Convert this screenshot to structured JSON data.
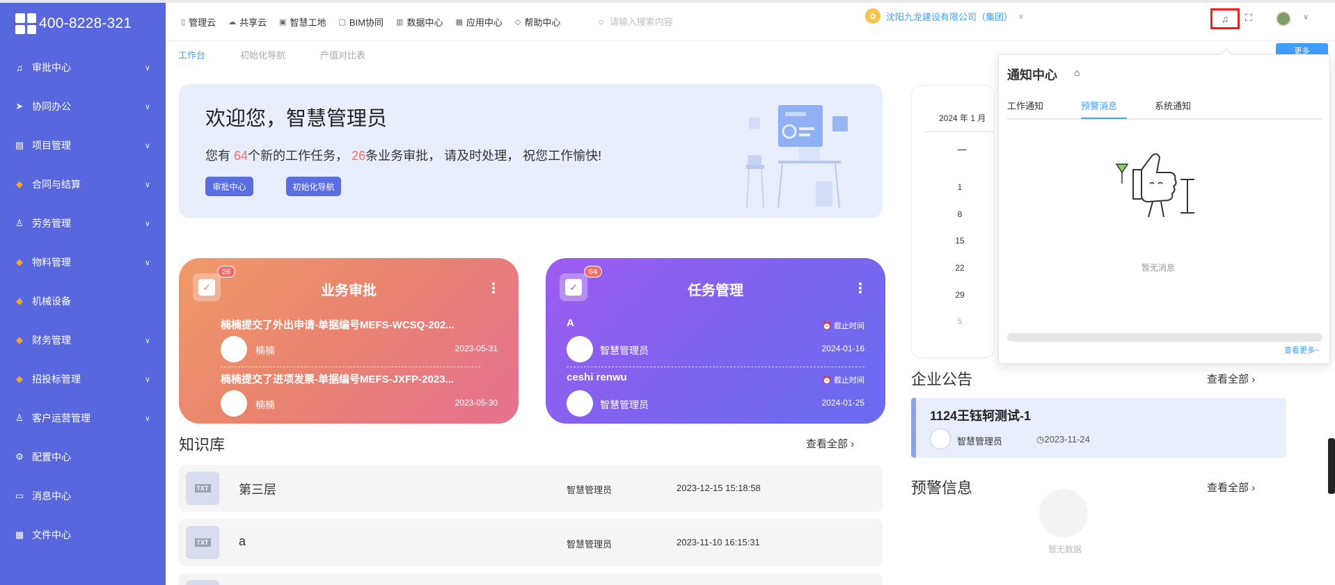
{
  "sidebar": {
    "phone": "400-8228-321",
    "items": [
      {
        "label": "审批中心",
        "icon": "bell-icon",
        "glyph": "♫",
        "has_children": true
      },
      {
        "label": "协同办公",
        "icon": "send-icon",
        "glyph": "➤",
        "has_children": true
      },
      {
        "label": "项目管理",
        "icon": "book-icon",
        "glyph": "▤",
        "has_children": true
      },
      {
        "label": "合同与结算",
        "icon": "diamond-icon",
        "glyph": "◆",
        "has_children": true
      },
      {
        "label": "劳务管理",
        "icon": "user-icon",
        "glyph": "♙",
        "has_children": true
      },
      {
        "label": "物料管理",
        "icon": "diamond-icon",
        "glyph": "◆",
        "has_children": true
      },
      {
        "label": "机械设备",
        "icon": "diamond-icon",
        "glyph": "◆",
        "has_children": false
      },
      {
        "label": "财务管理",
        "icon": "diamond-icon",
        "glyph": "◆",
        "has_children": true
      },
      {
        "label": "招投标管理",
        "icon": "diamond-icon",
        "glyph": "◆",
        "has_children": true
      },
      {
        "label": "客户运营管理",
        "icon": "user-icon",
        "glyph": "♙",
        "has_children": true
      },
      {
        "label": "配置中心",
        "icon": "gear-icon",
        "glyph": "⚙",
        "has_children": false
      },
      {
        "label": "消息中心",
        "icon": "message-icon",
        "glyph": "▭",
        "has_children": false
      },
      {
        "label": "文件中心",
        "icon": "file-icon",
        "glyph": "▦",
        "has_children": false
      }
    ]
  },
  "topnav": {
    "links": [
      "管理云",
      "共享云",
      "智慧工地",
      "BIM协同",
      "数据中心",
      "应用中心",
      "帮助中心"
    ],
    "search_placeholder": "请输入搜索内容",
    "company": "沈阳九龙建设有限公司（集团）"
  },
  "subnav": {
    "tabs": [
      "工作台",
      "初始化导航",
      "产值对比表"
    ],
    "active": 0,
    "more_label": "更多"
  },
  "welcome": {
    "title": "欢迎您，智慧管理员",
    "msg_pre": "您有 ",
    "tasks": "64",
    "msg_mid": "个新的工作任务， ",
    "approvals": "26",
    "msg_post": "条业务审批， 请及时处理， 祝您工作愉快!",
    "btn_approval": "审批中心",
    "btn_nav": "初始化导航"
  },
  "biz_card": {
    "title": "业务审批",
    "badge": "26",
    "items": [
      {
        "text": "楠楠提交了外出申请-单据编号MEFS-WCSQ-202...",
        "user": "楠楠",
        "date": "2023-05-31"
      },
      {
        "text": "楠楠提交了进项发票-单据编号MEFS-JXFP-2023...",
        "user": "楠楠",
        "date": "2023-05-30"
      }
    ]
  },
  "task_card": {
    "title": "任务管理",
    "badge": "64",
    "deadline_label": "截止时间",
    "items": [
      {
        "name": "A",
        "user": "智慧管理员",
        "date": "2024-01-16"
      },
      {
        "name": "ceshi renwu",
        "user": "智慧管理员",
        "date": "2024-01-25"
      }
    ]
  },
  "knowledge": {
    "title": "知识库",
    "view_all": "查看全部",
    "rows": [
      {
        "type": "TXT",
        "name": "第三层",
        "author": "智慧管理员",
        "time": "2023-12-15 15:18:58"
      },
      {
        "type": "TXT",
        "name": "a",
        "author": "智慧管理员",
        "time": "2023-11-10 16:15:31"
      }
    ]
  },
  "calendar": {
    "month": "2024 年 1 月",
    "dash": "一",
    "days": [
      "1",
      "8",
      "15",
      "22",
      "29",
      "5"
    ]
  },
  "announcements": {
    "title": "企业公告",
    "view_all": "查看全部",
    "item": {
      "title": "1124王钰轲测试-1",
      "user": "智慧管理员",
      "date": "2023-11-24"
    }
  },
  "warnings": {
    "title": "预警信息",
    "view_all": "查看全部",
    "empty": "暂无数据"
  },
  "notification_panel": {
    "title": "通知中心",
    "tabs": [
      "工作通知",
      "预警消息",
      "系统通知"
    ],
    "active_tab": 1,
    "empty": "暂无消息",
    "more": "查看更多~"
  },
  "colors": {
    "sidebar": "#5867dd",
    "accent": "#409eff",
    "highlight_red": "#f56c6c",
    "bell_outline": "#ff1a1a"
  }
}
